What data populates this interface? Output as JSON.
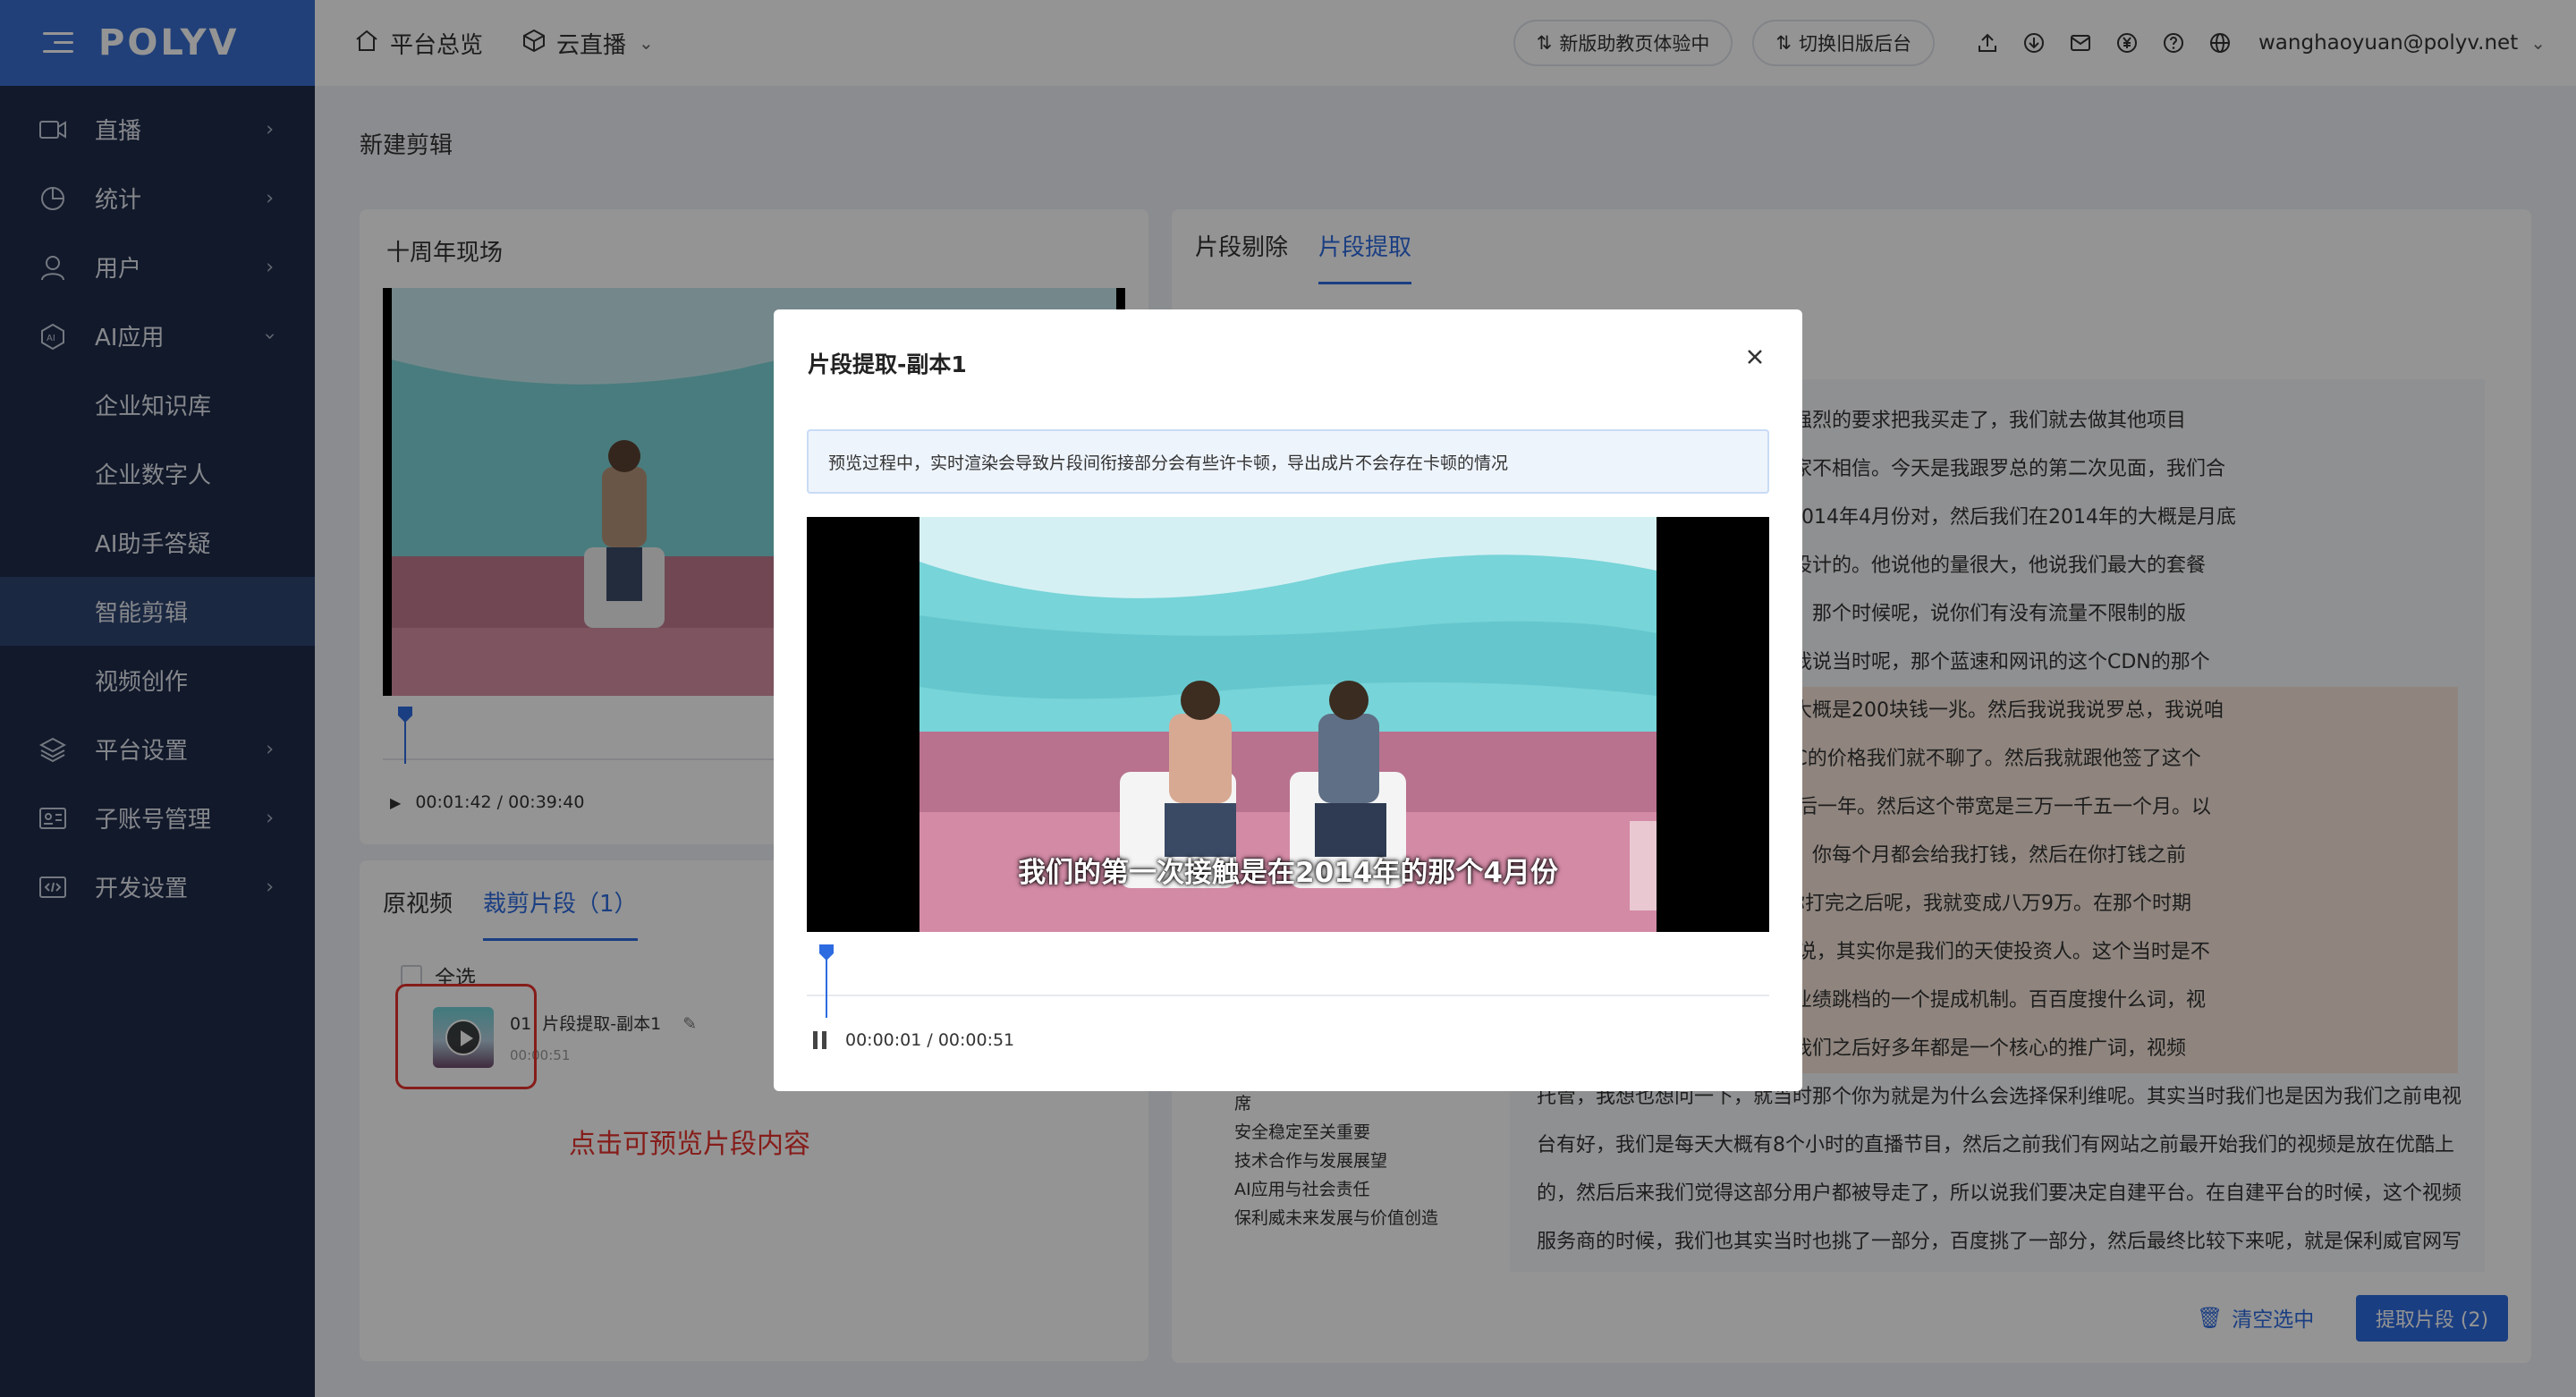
{
  "brand": "POLYV",
  "sidebar": {
    "items": [
      {
        "label": "直播",
        "icon": "video-icon"
      },
      {
        "label": "统计",
        "icon": "chart-icon"
      },
      {
        "label": "用户",
        "icon": "user-icon"
      },
      {
        "label": "AI应用",
        "icon": "ai-icon"
      }
    ],
    "sub": [
      "企业知识库",
      "企业数字人",
      "AI助手答疑",
      "智能剪辑",
      "视频创作"
    ],
    "items2": [
      {
        "label": "平台设置",
        "icon": "layers-icon"
      },
      {
        "label": "子账号管理",
        "icon": "id-card-icon"
      },
      {
        "label": "开发设置",
        "icon": "code-icon"
      }
    ]
  },
  "topbar": {
    "overview": "平台总览",
    "live": "云直播",
    "pill1": "新版助教页体验中",
    "pill2": "切换旧版后台",
    "user": "wanghaoyuan@polyv.net"
  },
  "page": {
    "title": "新建剪辑",
    "video_title": "十周年现场",
    "time": "00:01:42 / 00:39:40",
    "tabs": [
      "原视频",
      "裁剪片段（1）"
    ],
    "select_all": "全选",
    "clip": {
      "index": "01",
      "name": "片段提取-副本1",
      "duration": "00:00:51"
    },
    "note": "点击可预览片段内容"
  },
  "right": {
    "tabs": [
      "片段剔除",
      "片段提取"
    ],
    "transcript": [
      "这之后呢，有有一家上市公司强烈的要求把我买走了，我们就去做其他项目",
      "其实我我说一个事情，可能大家不相信。今天是我跟罗总的第二次见面，我们合",
      "是在2014年的那个4月份，22014年4月份对，然后我们在2014年的大概是月底",
      "签的那个合同呢，我是这么去设计的。他说他的量很大，他说我们最大的套餐",
      "多少。然后我们就聊，然后呢，那个时候呢，说你们有没有流量不限制的版",
      "后最终我们就设计这个套餐。我说当时呢，那个蓝速和网讯的这个CDN的那个",
      "不错，但是南讯特别特别贵，大概是200块钱一兆。然后我说我说罗总，我说咱",
      "块钱一兆卖给你。因为当时IDC的价格我们就不聊了。然后我就跟他签了这个",
      "限的套餐。我签了1g带宽，然后一年。然后这个带宽是三万一千五一个月。以",
      "后，那个时候在五月份六月份，你每个月都会给我打钱，然后在你打钱之前",
      "可能就是大概5万块钱，然后你打完之后呢，我就变成八万9万。在那个时期",
      "80%的业绩。我们在坊间传闻说，其实你是我们的天使投资人。这个当时是不",
      "当时谢总给我设置了一个叫做业绩跳档的一个提成机制。百百度搜什么词，视",
      "这个也就是奠定了我们未来。我们之后好多年都是一个核心的推广词，视频",
      "托管，我想也想问一下，就当时那个你为就是为什么会选择保利维呢。其实当时我们也是因为我们之前电视",
      "台有好，我们是每天大概有8个小时的直播节目，然后之前我们有网站之前最开始我们的视频是放在优酷上",
      "的，然后后来我们觉得这部分用户都被导走了，所以说我们要决定自建平台。在自建平台的时候，这个视频",
      "服务商的时候，我们也其实当时也挑了一部分，百度挑了一部分，然后最终比较下来呢，就是保利威官网写"
    ],
    "outline": [
      "席",
      "安全稳定至关重要",
      "技术合作与发展展望",
      "AI应用与社会责任",
      "保利威未来发展与价值创造"
    ],
    "clear": "清空选中",
    "extract": "提取片段 (2)",
    "marker_time": "00:01:42"
  },
  "modal": {
    "title": "片段提取-副本1",
    "notice": "预览过程中，实时渲染会导致片段间衔接部分会有些许卡顿，导出成片不会存在卡顿的情况",
    "subtitle": "我们的第一次接触是在2014年的那个4月份",
    "time": "00:00:01 / 00:00:51",
    "progress": 0.02
  },
  "colors": {
    "accent": "#2d6be0",
    "sidebar": "#1e2b4a",
    "annotation": "#e5322d"
  }
}
